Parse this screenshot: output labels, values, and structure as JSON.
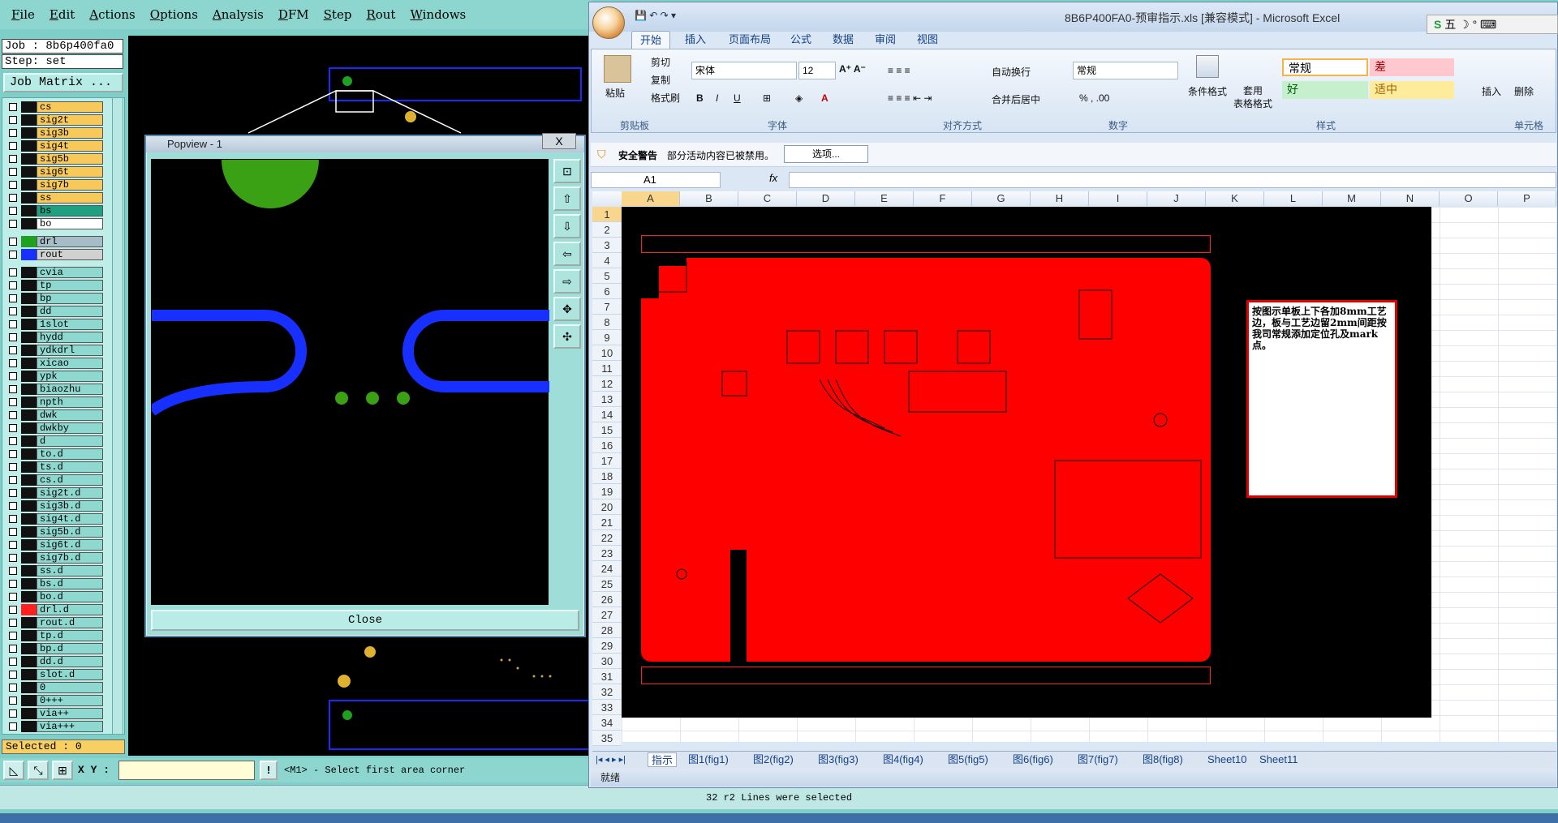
{
  "genesis": {
    "menu": [
      "File",
      "Edit",
      "Actions",
      "Options",
      "Analysis",
      "DFM",
      "Step",
      "Rout",
      "Windows"
    ],
    "job_label": "Job : 8b6p400fa0",
    "step_label": "Step: set",
    "job_matrix_button": "Job Matrix ...",
    "layers": [
      {
        "name": "cs",
        "color": "#f7c85a",
        "swatch": "#111"
      },
      {
        "name": "sig2t",
        "color": "#f7c85a",
        "swatch": "#111"
      },
      {
        "name": "sig3b",
        "color": "#f7c85a",
        "swatch": "#111"
      },
      {
        "name": "sig4t",
        "color": "#f7c85a",
        "swatch": "#111"
      },
      {
        "name": "sig5b",
        "color": "#f7c85a",
        "swatch": "#111"
      },
      {
        "name": "sig6t",
        "color": "#f7c85a",
        "swatch": "#111"
      },
      {
        "name": "sig7b",
        "color": "#f7c85a",
        "swatch": "#111"
      },
      {
        "name": "ss",
        "color": "#f7c85a",
        "swatch": "#111"
      },
      {
        "name": "bs",
        "color": "#20a080",
        "swatch": "#111"
      },
      {
        "name": "bo",
        "color": "#ffffff",
        "swatch": "#111"
      },
      {
        "name": "drl",
        "color": "#a6bcc6",
        "swatch": "#20a020"
      },
      {
        "name": "rout",
        "color": "#d0d0d0",
        "swatch": "#1830ff"
      },
      {
        "name": "cvia",
        "color": "#8fd8cf",
        "swatch": "#111"
      },
      {
        "name": "tp",
        "color": "#8fd8cf",
        "swatch": "#111"
      },
      {
        "name": "bp",
        "color": "#8fd8cf",
        "swatch": "#111"
      },
      {
        "name": "dd",
        "color": "#8fd8cf",
        "swatch": "#111"
      },
      {
        "name": "1slot",
        "color": "#8fd8cf",
        "swatch": "#111"
      },
      {
        "name": "hydd",
        "color": "#8fd8cf",
        "swatch": "#111"
      },
      {
        "name": "ydkdrl",
        "color": "#8fd8cf",
        "swatch": "#111"
      },
      {
        "name": "xicao",
        "color": "#8fd8cf",
        "swatch": "#111"
      },
      {
        "name": "ypk",
        "color": "#8fd8cf",
        "swatch": "#111"
      },
      {
        "name": "biaozhu",
        "color": "#8fd8cf",
        "swatch": "#111"
      },
      {
        "name": "npth",
        "color": "#8fd8cf",
        "swatch": "#111"
      },
      {
        "name": "dwk",
        "color": "#8fd8cf",
        "swatch": "#111"
      },
      {
        "name": "dwkby",
        "color": "#8fd8cf",
        "swatch": "#111"
      },
      {
        "name": "d",
        "color": "#8fd8cf",
        "swatch": "#111"
      },
      {
        "name": "to.d",
        "color": "#8fd8cf",
        "swatch": "#111"
      },
      {
        "name": "ts.d",
        "color": "#8fd8cf",
        "swatch": "#111"
      },
      {
        "name": "cs.d",
        "color": "#8fd8cf",
        "swatch": "#111"
      },
      {
        "name": "sig2t.d",
        "color": "#8fd8cf",
        "swatch": "#111"
      },
      {
        "name": "sig3b.d",
        "color": "#8fd8cf",
        "swatch": "#111"
      },
      {
        "name": "sig4t.d",
        "color": "#8fd8cf",
        "swatch": "#111"
      },
      {
        "name": "sig5b.d",
        "color": "#8fd8cf",
        "swatch": "#111"
      },
      {
        "name": "sig6t.d",
        "color": "#8fd8cf",
        "swatch": "#111"
      },
      {
        "name": "sig7b.d",
        "color": "#8fd8cf",
        "swatch": "#111"
      },
      {
        "name": "ss.d",
        "color": "#8fd8cf",
        "swatch": "#111"
      },
      {
        "name": "bs.d",
        "color": "#8fd8cf",
        "swatch": "#111"
      },
      {
        "name": "bo.d",
        "color": "#8fd8cf",
        "swatch": "#111"
      },
      {
        "name": "drl.d",
        "color": "#8fd8cf",
        "swatch": "#ff2020"
      },
      {
        "name": "rout.d",
        "color": "#8fd8cf",
        "swatch": "#111"
      },
      {
        "name": "tp.d",
        "color": "#8fd8cf",
        "swatch": "#111"
      },
      {
        "name": "bp.d",
        "color": "#8fd8cf",
        "swatch": "#111"
      },
      {
        "name": "dd.d",
        "color": "#8fd8cf",
        "swatch": "#111"
      },
      {
        "name": "slot.d",
        "color": "#8fd8cf",
        "swatch": "#111"
      },
      {
        "name": "0",
        "color": "#8fd8cf",
        "swatch": "#111"
      },
      {
        "name": "0+++",
        "color": "#8fd8cf",
        "swatch": "#111"
      },
      {
        "name": "via++",
        "color": "#8fd8cf",
        "swatch": "#111"
      },
      {
        "name": "via+++",
        "color": "#8fd8cf",
        "swatch": "#111"
      }
    ],
    "selected": "Selected : 0",
    "xy_label": "X Y :",
    "prompt": "<M1> - Select first area corner",
    "status": "32 r2 Lines were selected"
  },
  "popview": {
    "title": "Popview - 1",
    "close_x": "X",
    "close_button": "Close"
  },
  "excel": {
    "title": "8B6P400FA0-预审指示.xls [兼容模式] - Microsoft Excel",
    "tabs": [
      "开始",
      "插入",
      "页面布局",
      "公式",
      "数据",
      "审阅",
      "视图"
    ],
    "clipboard": {
      "paste": "粘贴",
      "cut": "剪切",
      "copy": "复制",
      "format_painter": "格式刷",
      "group": "剪贴板"
    },
    "font": {
      "name": "宋体",
      "size": "12",
      "group": "字体"
    },
    "alignment": {
      "wrap": "自动换行",
      "merge": "合并后居中",
      "group": "对齐方式"
    },
    "number": {
      "format": "常规",
      "group": "数字"
    },
    "styles": {
      "conditional": "条件格式",
      "table_format": "套用\n表格格式",
      "normal": "常规",
      "bad": "差",
      "good": "好",
      "neutral": "适中",
      "group": "样式"
    },
    "cells": {
      "insert": "插入",
      "delete": "删除",
      "group": "单元格"
    },
    "security": {
      "label": "安全警告",
      "message": "部分活动内容已被禁用。",
      "options": "选项..."
    },
    "name_box": "A1",
    "fx": "fx",
    "columns": [
      "A",
      "B",
      "C",
      "D",
      "E",
      "F",
      "G",
      "H",
      "I",
      "J",
      "K",
      "L",
      "M",
      "N",
      "O",
      "P"
    ],
    "rows": [
      "1",
      "2",
      "3",
      "4",
      "5",
      "6",
      "7",
      "8",
      "9",
      "10",
      "11",
      "12",
      "13",
      "14",
      "15",
      "16",
      "17",
      "18",
      "19",
      "20",
      "21",
      "22",
      "23",
      "24",
      "25",
      "26",
      "27",
      "28",
      "29",
      "30",
      "31",
      "32",
      "33",
      "34",
      "35"
    ],
    "note": "按图示单板上下各加8mm工艺边，板与工艺边留2mm间距按我司常规添加定位孔及mark点。",
    "sheet_tabs": [
      "指示",
      "图1(fig1)",
      "图2(fig2)",
      "图3(fig3)",
      "图4(fig4)",
      "图5(fig5)",
      "图6(fig6)",
      "图7(fig7)",
      "图8(fig8)",
      "Sheet10",
      "Sheet11"
    ],
    "status": "就绪",
    "ime": "五 ☽ ° ⌨"
  },
  "colors": {
    "genesis_bg": "#8dd6cf",
    "pcb_red": "#ff0000",
    "rout_blue": "#1830ff",
    "drill_green": "#20a020"
  }
}
